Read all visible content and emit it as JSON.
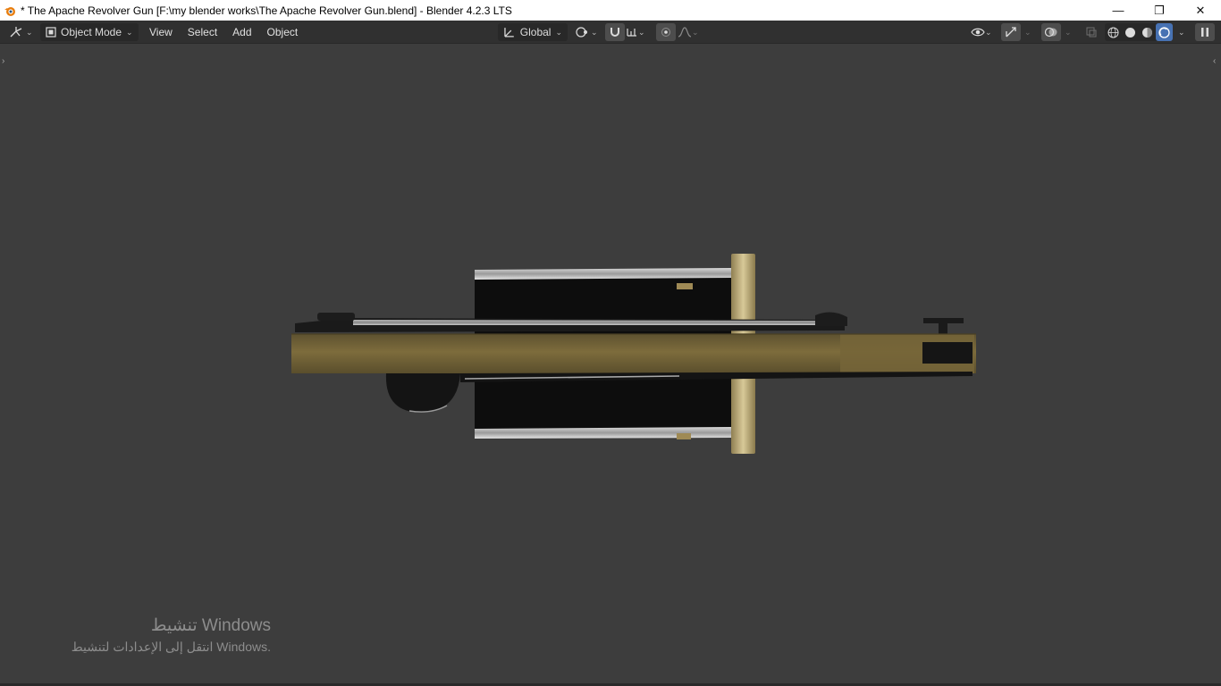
{
  "window": {
    "title": "* The Apache Revolver Gun [F:\\my blender works\\The Apache Revolver Gun.blend] - Blender 4.2.3 LTS",
    "app_icon": "blender-logo-icon",
    "controls": {
      "minimize": "—",
      "restore": "❐",
      "close": "✕"
    }
  },
  "header": {
    "editor_type_icon": "3d-viewport-icon",
    "mode": {
      "label": "Object Mode",
      "icon": "object-mode-icon"
    },
    "menus": [
      "View",
      "Select",
      "Add",
      "Object"
    ],
    "transform_orientation": {
      "label": "Global",
      "icon": "orientation-icon"
    },
    "right_icons": [
      "visibility-eye-icon",
      "gizmo-icon",
      "overlay-icon",
      "xray-icon"
    ],
    "shading_modes": [
      "wireframe",
      "solid",
      "material-preview",
      "rendered"
    ],
    "active_shading": "rendered"
  },
  "watermark": {
    "line1": "تنشيط Windows",
    "line2": "انتقل إلى الإعدادات لتنشيط Windows."
  },
  "colors": {
    "viewport_bg": "#3d3d3d",
    "header_bg": "#303030",
    "accent": "#4772b3",
    "wood": "#7a6a3a",
    "brass": "#c9b88a"
  }
}
